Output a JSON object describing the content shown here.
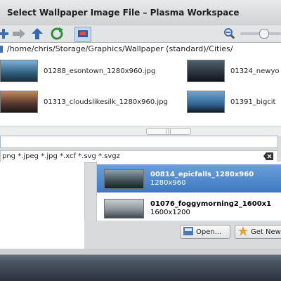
{
  "window": {
    "title": "Select Wallpaper Image File – Plasma Workspace"
  },
  "toolbar": {
    "icons": [
      "add-icon",
      "forward-arrow-icon",
      "up-arrow-icon",
      "reload-icon",
      "preview-icon"
    ],
    "zoom_icon": "zoom-out-icon",
    "zoom_level": 0.55
  },
  "location": {
    "path": "/home/chris/Storage/Graphics/Wallpaper (standard)/Cities/"
  },
  "files": [
    {
      "name": "01288_esontown_1280x960.jpg",
      "color": "#3f6e93"
    },
    {
      "name": "01324_newyo",
      "color": "#2c3a48"
    },
    {
      "name": "01313_cloudslikesilk_1280x960.jpg",
      "color": "#5a4038"
    },
    {
      "name": "01391_bigcit",
      "color": "#4a7fb0"
    }
  ],
  "name_input": {
    "value": ""
  },
  "filter": {
    "text": "png *.jpeg *.jpg *.xcf *.svg *.svgz"
  },
  "wallpapers": [
    {
      "name": "00814_epicfalls_1280x960",
      "dims": "1280x960",
      "selected": true
    },
    {
      "name": "01076_foggymorning2_1600x1",
      "dims": "1600x1200",
      "selected": false
    }
  ],
  "buttons": {
    "open": "Open...",
    "get_new": "Get New"
  },
  "scrollbar": {
    "handle_label": "|||"
  }
}
